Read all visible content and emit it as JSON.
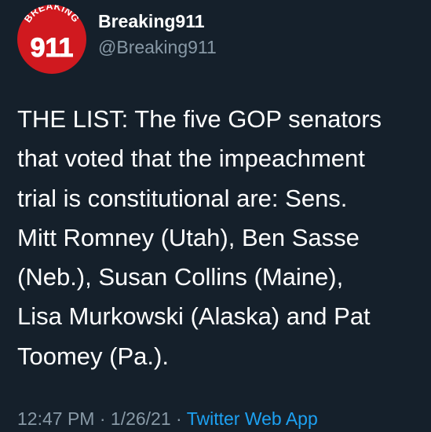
{
  "author": {
    "avatar_icon": "breaking911-logo",
    "avatar_text": "BREAKING",
    "avatar_number": "911",
    "avatar_color": "#d0191f",
    "display_name": "Breaking911",
    "handle": "@Breaking911"
  },
  "tweet": {
    "text": "THE LIST: The five GOP senators\nthat voted that the impeachment\ntrial is constitutional are: Sens.\nMitt Romney (Utah), Ben Sasse\n(Neb.), Susan Collins (Maine),\nLisa Murkowski (Alaska) and Pat\nToomey (Pa.)."
  },
  "meta": {
    "time": "12:47 PM",
    "separator_1": "·",
    "date": "1/26/21",
    "separator_2": "·",
    "source": "Twitter Web App"
  },
  "colors": {
    "background": "#15202b",
    "text": "#ffffff",
    "secondary_text": "#8899a6",
    "link": "#1da1f2"
  }
}
